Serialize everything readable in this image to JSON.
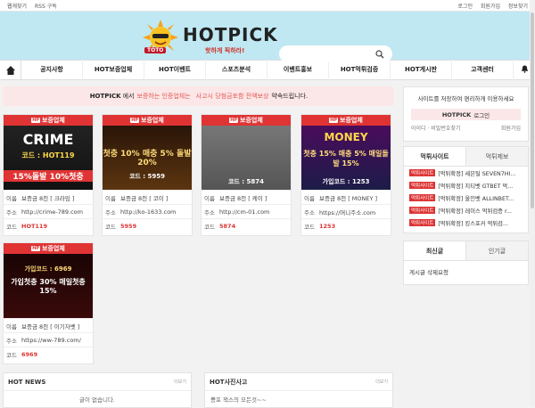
{
  "topbar": {
    "left": [
      "웹캐찾기",
      "RSS 구독"
    ],
    "right": [
      "로그인",
      "회원가입",
      "정보찾기"
    ]
  },
  "header": {
    "brand": "HOTPICK",
    "slogan": "핫하게 픽하라!",
    "badge": "TOTO",
    "search_placeholder": "",
    "search_icon": "search-icon"
  },
  "nav": {
    "items": [
      "공지사항",
      "HOT보증업체",
      "HOT이벤트",
      "스포츠분석",
      "이벤트홍보",
      "HOT먹튀검증",
      "HOT게시판",
      "고객센터"
    ]
  },
  "notice": {
    "logo": "HOTPICK",
    "p1": "에서",
    "hl1": "보증하는 인증업체는",
    "hl2": "사고시 당첨금포함 전액보상",
    "p2": "약속드립니다."
  },
  "cards": [
    {
      "header": "보증업체",
      "banner": "CRIME",
      "code_line": "코드 : HOT119",
      "promo": "15%돌발 10%첫충",
      "deposit": "보증금 8천 [ 크라임 ]",
      "url": "http://crime-789.com",
      "code": "HOT119"
    },
    {
      "header": "보증업체",
      "banner": "",
      "code_line": "코드 : 5959",
      "promo": "첫충 10% 매충 5% 돌발 20%",
      "deposit": "보증금 8천 [ 코이 ]",
      "url": "http://ko-1633.com",
      "code": "5959"
    },
    {
      "header": "보증업체",
      "banner": "",
      "code_line": "코드 : 5874",
      "promo": "",
      "deposit": "보증금 8천 [ 케이 ]",
      "url": "http://cm-01.com",
      "code": "5874"
    },
    {
      "header": "보증업체",
      "banner": "MONEY",
      "code_line": "가입코드 : 1253",
      "promo": "첫충 15% 매충 5% 매일돌발 15%",
      "deposit": "보증금 8천 [ MONEY ]",
      "url": "https://머니주소.com",
      "code": "1253"
    },
    {
      "header": "보증업체",
      "banner": "",
      "code_line": "가입코드 : 6969",
      "promo": "가입첫충 30% 매일첫충 15%",
      "deposit": "보증금 8천 [ 이기자벳 ]",
      "url": "https://ww-789.com/",
      "code": "6969"
    }
  ],
  "labels": {
    "deposit": "이름",
    "url": "주소",
    "code": "코드"
  },
  "panels": [
    {
      "title": "HOT NEWS",
      "more": "더보기",
      "body": "글이 없습니다."
    },
    {
      "title": "HOT사진사고",
      "more": "더보기",
      "body": "뽕포 잭스의 모든것~~"
    }
  ],
  "sidebar": {
    "login_msg": "사이트를 저장하여 편리하게 이용하세요",
    "login_btn": "로그인",
    "login_logo": "HOTPICK",
    "find": "아이디 · 비밀번호찾기",
    "join": "회원가입",
    "tab1": "먹튀사이트",
    "tab2": "먹튀제보",
    "items": [
      {
        "tag": "먹튀사이트",
        "text": "[먹튀확정] 세븐틸 SEVEN7HI..."
      },
      {
        "tag": "먹튀사이트",
        "text": "[먹튀확정] 지티벳 GTBET 먹..."
      },
      {
        "tag": "먹튀사이트",
        "text": "[먹튀확정] 올인벳 ALLINBET..."
      },
      {
        "tag": "먹튀사이트",
        "text": "[먹튀확정] 레이스 먹튀검증 r..."
      },
      {
        "tag": "먹튀사이트",
        "text": "[먹튀확정] 킹스포커 먹튀검..."
      }
    ],
    "tab3": "최신글",
    "tab4": "인기글",
    "latest": "게시글 삭제요청"
  },
  "colors": {
    "accent": "#e03434",
    "header_bg": "#bfe8f3",
    "notice_bg": "#fbe7e7"
  }
}
